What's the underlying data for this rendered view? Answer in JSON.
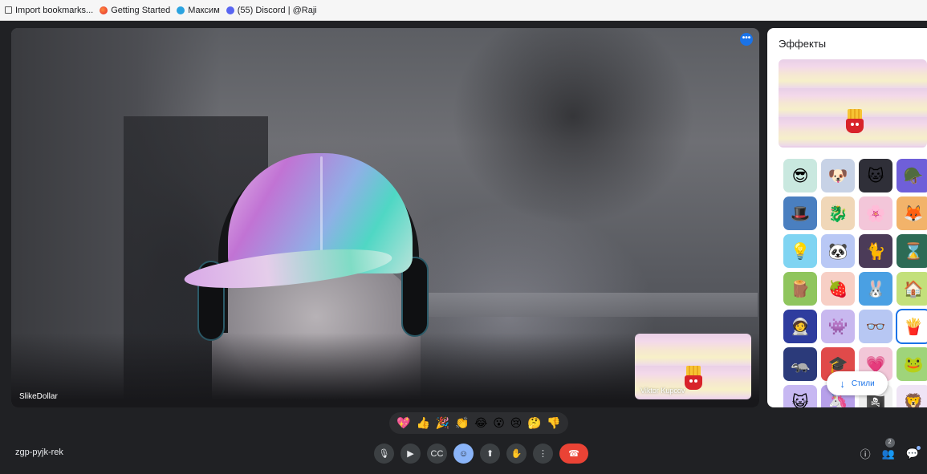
{
  "bookmarks": [
    {
      "label": "Import bookmarks...",
      "icon": "import-icon"
    },
    {
      "label": "Getting Started",
      "icon": "firefox-icon"
    },
    {
      "label": "Максим",
      "icon": "telegram-icon"
    },
    {
      "label": "(55) Discord | @Raji",
      "icon": "discord-icon"
    }
  ],
  "main_video": {
    "participant_name": "SlikeDollar",
    "more_label": "•••"
  },
  "self_view": {
    "participant_name": "Viktor Kupcov"
  },
  "effects_panel": {
    "title": "Эффекты",
    "styles_button": "Стили",
    "styles_arrow": "↓",
    "tiles": [
      {
        "icon": "sunglasses",
        "glyph": "😎",
        "bg": "#c9e8df"
      },
      {
        "icon": "dog",
        "glyph": "🐶",
        "bg": "#c7d2e6"
      },
      {
        "icon": "cat",
        "glyph": "🐱",
        "bg": "#2f2f38"
      },
      {
        "icon": "helmet",
        "glyph": "🪖",
        "bg": "#6f5fd9"
      },
      {
        "icon": "hat",
        "glyph": "🎩",
        "bg": "#4a7fc0"
      },
      {
        "icon": "dragon",
        "glyph": "🐉",
        "bg": "#f0d7b8"
      },
      {
        "icon": "blossom",
        "glyph": "🌸",
        "bg": "#f3c6d9"
      },
      {
        "icon": "fox",
        "glyph": "🦊",
        "bg": "#f2b36a"
      },
      {
        "icon": "bulb",
        "glyph": "💡",
        "bg": "#7fd4f2"
      },
      {
        "icon": "panda",
        "glyph": "🐼",
        "bg": "#b9c8f5"
      },
      {
        "icon": "black-cat",
        "glyph": "🐈",
        "bg": "#4b3b58"
      },
      {
        "icon": "hourglass",
        "glyph": "⌛",
        "bg": "#2d6b55"
      },
      {
        "icon": "log",
        "glyph": "🪵",
        "bg": "#8fc55d"
      },
      {
        "icon": "strawberry",
        "glyph": "🍓",
        "bg": "#f7cfc5"
      },
      {
        "icon": "bunny",
        "glyph": "🐰",
        "bg": "#4aa0e3"
      },
      {
        "icon": "house",
        "glyph": "🏠",
        "bg": "#c3e07b"
      },
      {
        "icon": "astronaut",
        "glyph": "🧑‍🚀",
        "bg": "#2e3c9e"
      },
      {
        "icon": "creature",
        "glyph": "👾",
        "bg": "#c8b8ef"
      },
      {
        "icon": "glasses",
        "glyph": "👓",
        "bg": "#b7c7f3"
      },
      {
        "icon": "fries",
        "glyph": "🍟",
        "bg": "#ffffff",
        "selected": true
      },
      {
        "icon": "night-animal",
        "glyph": "🦡",
        "bg": "#2b3a7a"
      },
      {
        "icon": "graduation-cap",
        "glyph": "🎓",
        "bg": "#e04a4a"
      },
      {
        "icon": "heart",
        "glyph": "💗",
        "bg": "#f2c7d8"
      },
      {
        "icon": "frog",
        "glyph": "🐸",
        "bg": "#9fd47a"
      },
      {
        "icon": "purple-cat",
        "glyph": "😺",
        "bg": "#c7b8f2"
      },
      {
        "icon": "purple-character",
        "glyph": "🦄",
        "bg": "#b7a0ea"
      },
      {
        "icon": "pirate",
        "glyph": "🏴‍☠️",
        "bg": "#f0f0f0"
      },
      {
        "icon": "lion",
        "glyph": "🦁",
        "bg": "#efe4f5"
      }
    ]
  },
  "reactions": [
    {
      "icon": "heart",
      "glyph": "💖"
    },
    {
      "icon": "thumbs-up",
      "glyph": "👍"
    },
    {
      "icon": "party",
      "glyph": "🎉"
    },
    {
      "icon": "clap",
      "glyph": "👏"
    },
    {
      "icon": "laugh",
      "glyph": "😂"
    },
    {
      "icon": "surprised",
      "glyph": "😮"
    },
    {
      "icon": "sad",
      "glyph": "😢"
    },
    {
      "icon": "thinking",
      "glyph": "🤔"
    },
    {
      "icon": "thumbs-down",
      "glyph": "👎"
    }
  ],
  "meeting": {
    "code": "zgp-pyjk-rek",
    "participants_count": "2"
  },
  "controls": [
    {
      "name": "mic-button",
      "icon": "mic-icon",
      "glyph": "🎙"
    },
    {
      "name": "camera-button",
      "icon": "camera-icon",
      "glyph": "▶"
    },
    {
      "name": "captions-button",
      "icon": "captions-icon",
      "glyph": "CC"
    },
    {
      "name": "reactions-button",
      "icon": "emoji-icon",
      "glyph": "☺",
      "active": true
    },
    {
      "name": "present-button",
      "icon": "present-icon",
      "glyph": "⬆"
    },
    {
      "name": "raise-hand-button",
      "icon": "hand-icon",
      "glyph": "✋"
    },
    {
      "name": "more-options-button",
      "icon": "more-vert-icon",
      "glyph": "⋮"
    },
    {
      "name": "end-call-button",
      "icon": "phone-hangup-icon",
      "glyph": "☎",
      "end": true
    }
  ],
  "right_controls": [
    {
      "name": "info-button",
      "icon": "info-icon",
      "glyph": "ⓘ"
    },
    {
      "name": "people-button",
      "icon": "people-icon",
      "glyph": "👥"
    },
    {
      "name": "chat-button",
      "icon": "chat-icon",
      "glyph": "💬"
    }
  ]
}
